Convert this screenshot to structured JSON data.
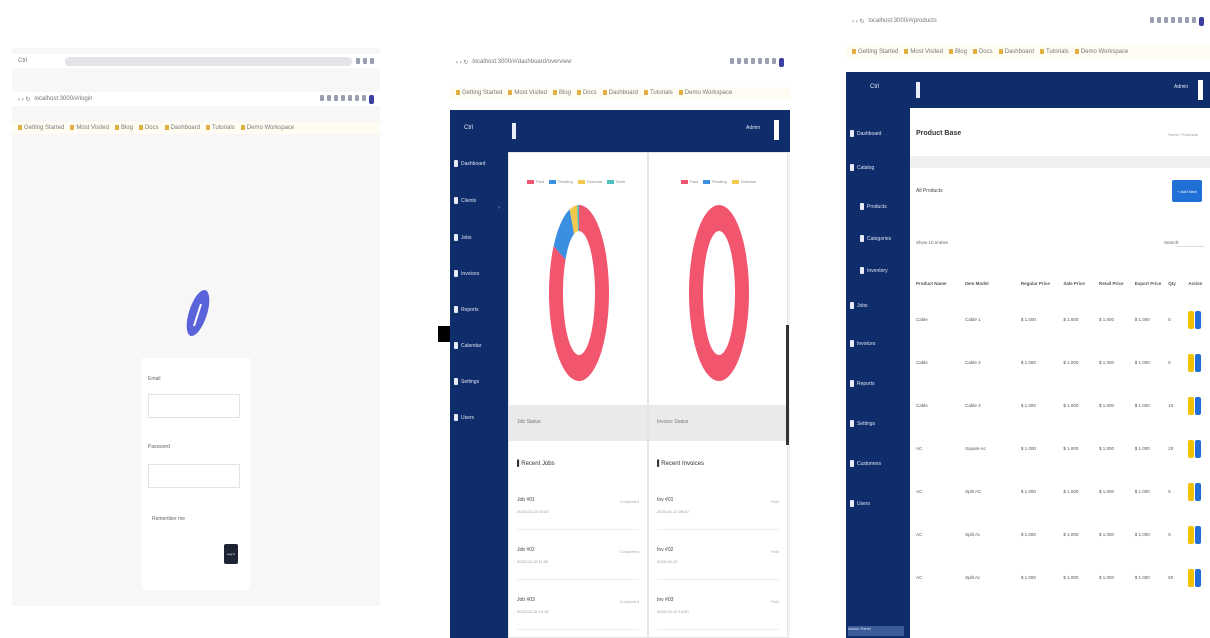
{
  "panel1": {
    "tab_title": "Ctrl",
    "url": "localhost:3000/#/login",
    "bookmarks": [
      "Getting Started",
      "Most Visited",
      "Blog",
      "Docs",
      "Dashboard",
      "Tutorials",
      "Demo Workspace"
    ],
    "form": {
      "email_label": "Email",
      "password_label": "Password",
      "remember_label": "Remember me",
      "submit_label": "Log in"
    }
  },
  "panel2": {
    "url": "localhost:3000/#/dashboard/overview",
    "bookmarks": [
      "Getting Started",
      "Most Visited",
      "Blog",
      "Docs",
      "Dashboard",
      "Tutorials",
      "Demo Workspace"
    ],
    "header": {
      "brand": "Ctrl",
      "user": "Admin"
    },
    "sidebar": [
      "Dashboard",
      "Clients",
      "Jobs",
      "Invoices",
      "Reports",
      "Calendar",
      "Settings",
      "Users"
    ],
    "cards": [
      {
        "legend": [
          "Paid",
          "Pending",
          "Overdue",
          "Draft"
        ],
        "footer": "Job Status",
        "list_title": "Recent Jobs",
        "items": [
          {
            "title": "Job #01",
            "date": "2023-04-12 10:30",
            "status": "Completed"
          },
          {
            "title": "Job #02",
            "date": "2023-04-12 11:00",
            "status": "Completed"
          },
          {
            "title": "Job #03",
            "date": "2023-04-12 12:15",
            "status": "Completed"
          }
        ]
      },
      {
        "legend": [
          "Paid",
          "Pending",
          "Overdue"
        ],
        "footer": "Invoice Status",
        "list_title": "Recent Invoices",
        "items": [
          {
            "title": "Inv #01",
            "date": "2023-04-12 09:40",
            "status": "Paid"
          },
          {
            "title": "Inv #02",
            "date": "2023-04-12",
            "status": "Paid"
          },
          {
            "title": "Inv #03",
            "date": "2023-04-12 14:20",
            "status": "Paid"
          }
        ]
      }
    ],
    "chart_data": [
      {
        "type": "pie",
        "categories": [
          "Paid",
          "Pending",
          "Overdue",
          "Draft"
        ],
        "values": [
          84,
          11,
          4,
          1
        ],
        "colors": [
          "#f2556e",
          "#3a8fe0",
          "#f2c94c",
          "#4cc1bb"
        ]
      },
      {
        "type": "pie",
        "categories": [
          "Paid",
          "Pending",
          "Overdue"
        ],
        "values": [
          100,
          0,
          0
        ],
        "colors": [
          "#f2556e",
          "#3a8fe0",
          "#f2c94c"
        ]
      }
    ]
  },
  "panel3": {
    "url": "localhost:3000/#/products",
    "bookmarks": [
      "Getting Started",
      "Most Visited",
      "Blog",
      "Docs",
      "Dashboard",
      "Tutorials",
      "Demo Workspace"
    ],
    "header": {
      "brand": "Ctrl",
      "user": "Admin"
    },
    "sidebar": [
      "Dashboard",
      "Catalog",
      "Products",
      "Categories",
      "Inventory",
      "Jobs",
      "Invoices",
      "Reports",
      "Settings",
      "Customers",
      "Users"
    ],
    "page_title": "Product Base",
    "breadcrumb": "Home / Products",
    "section_title": "All Products",
    "add_button": "+ Add New",
    "show_entries": "Show 10 entries",
    "search_label": "Search:",
    "columns": [
      "Product Name",
      "Item Model",
      "Regular Price",
      "Sale Price",
      "Retail Price",
      "Export Price",
      "Qty",
      "Action"
    ],
    "rows": [
      [
        "Cable",
        "Cable 1",
        "$ 1.000",
        "$ 1.000",
        "$ 1.000",
        "$ 1.000",
        "5"
      ],
      [
        "Cable",
        "Cable 2",
        "$ 1.000",
        "$ 1.000",
        "$ 1.000",
        "$ 1.000",
        "5"
      ],
      [
        "Cable",
        "Cable 3",
        "$ 1.000",
        "$ 1.000",
        "$ 1.000",
        "$ 1.000",
        "10"
      ],
      [
        "AC",
        "Square Ac",
        "$ 1.000",
        "$ 1.000",
        "$ 1.000",
        "$ 1.000",
        "20"
      ],
      [
        "AC",
        "Split AC",
        "$ 1.000",
        "$ 1.000",
        "$ 1.000",
        "$ 1.000",
        "5"
      ],
      [
        "AC",
        "Split Ac",
        "$ 1.000",
        "$ 1.000",
        "$ 1.000",
        "$ 1.000",
        "5"
      ],
      [
        "AC",
        "Split Ac",
        "$ 1.000",
        "$ 1.000",
        "$ 1.000",
        "$ 1.000",
        "50"
      ]
    ],
    "footer_button": "Admin Panel"
  }
}
